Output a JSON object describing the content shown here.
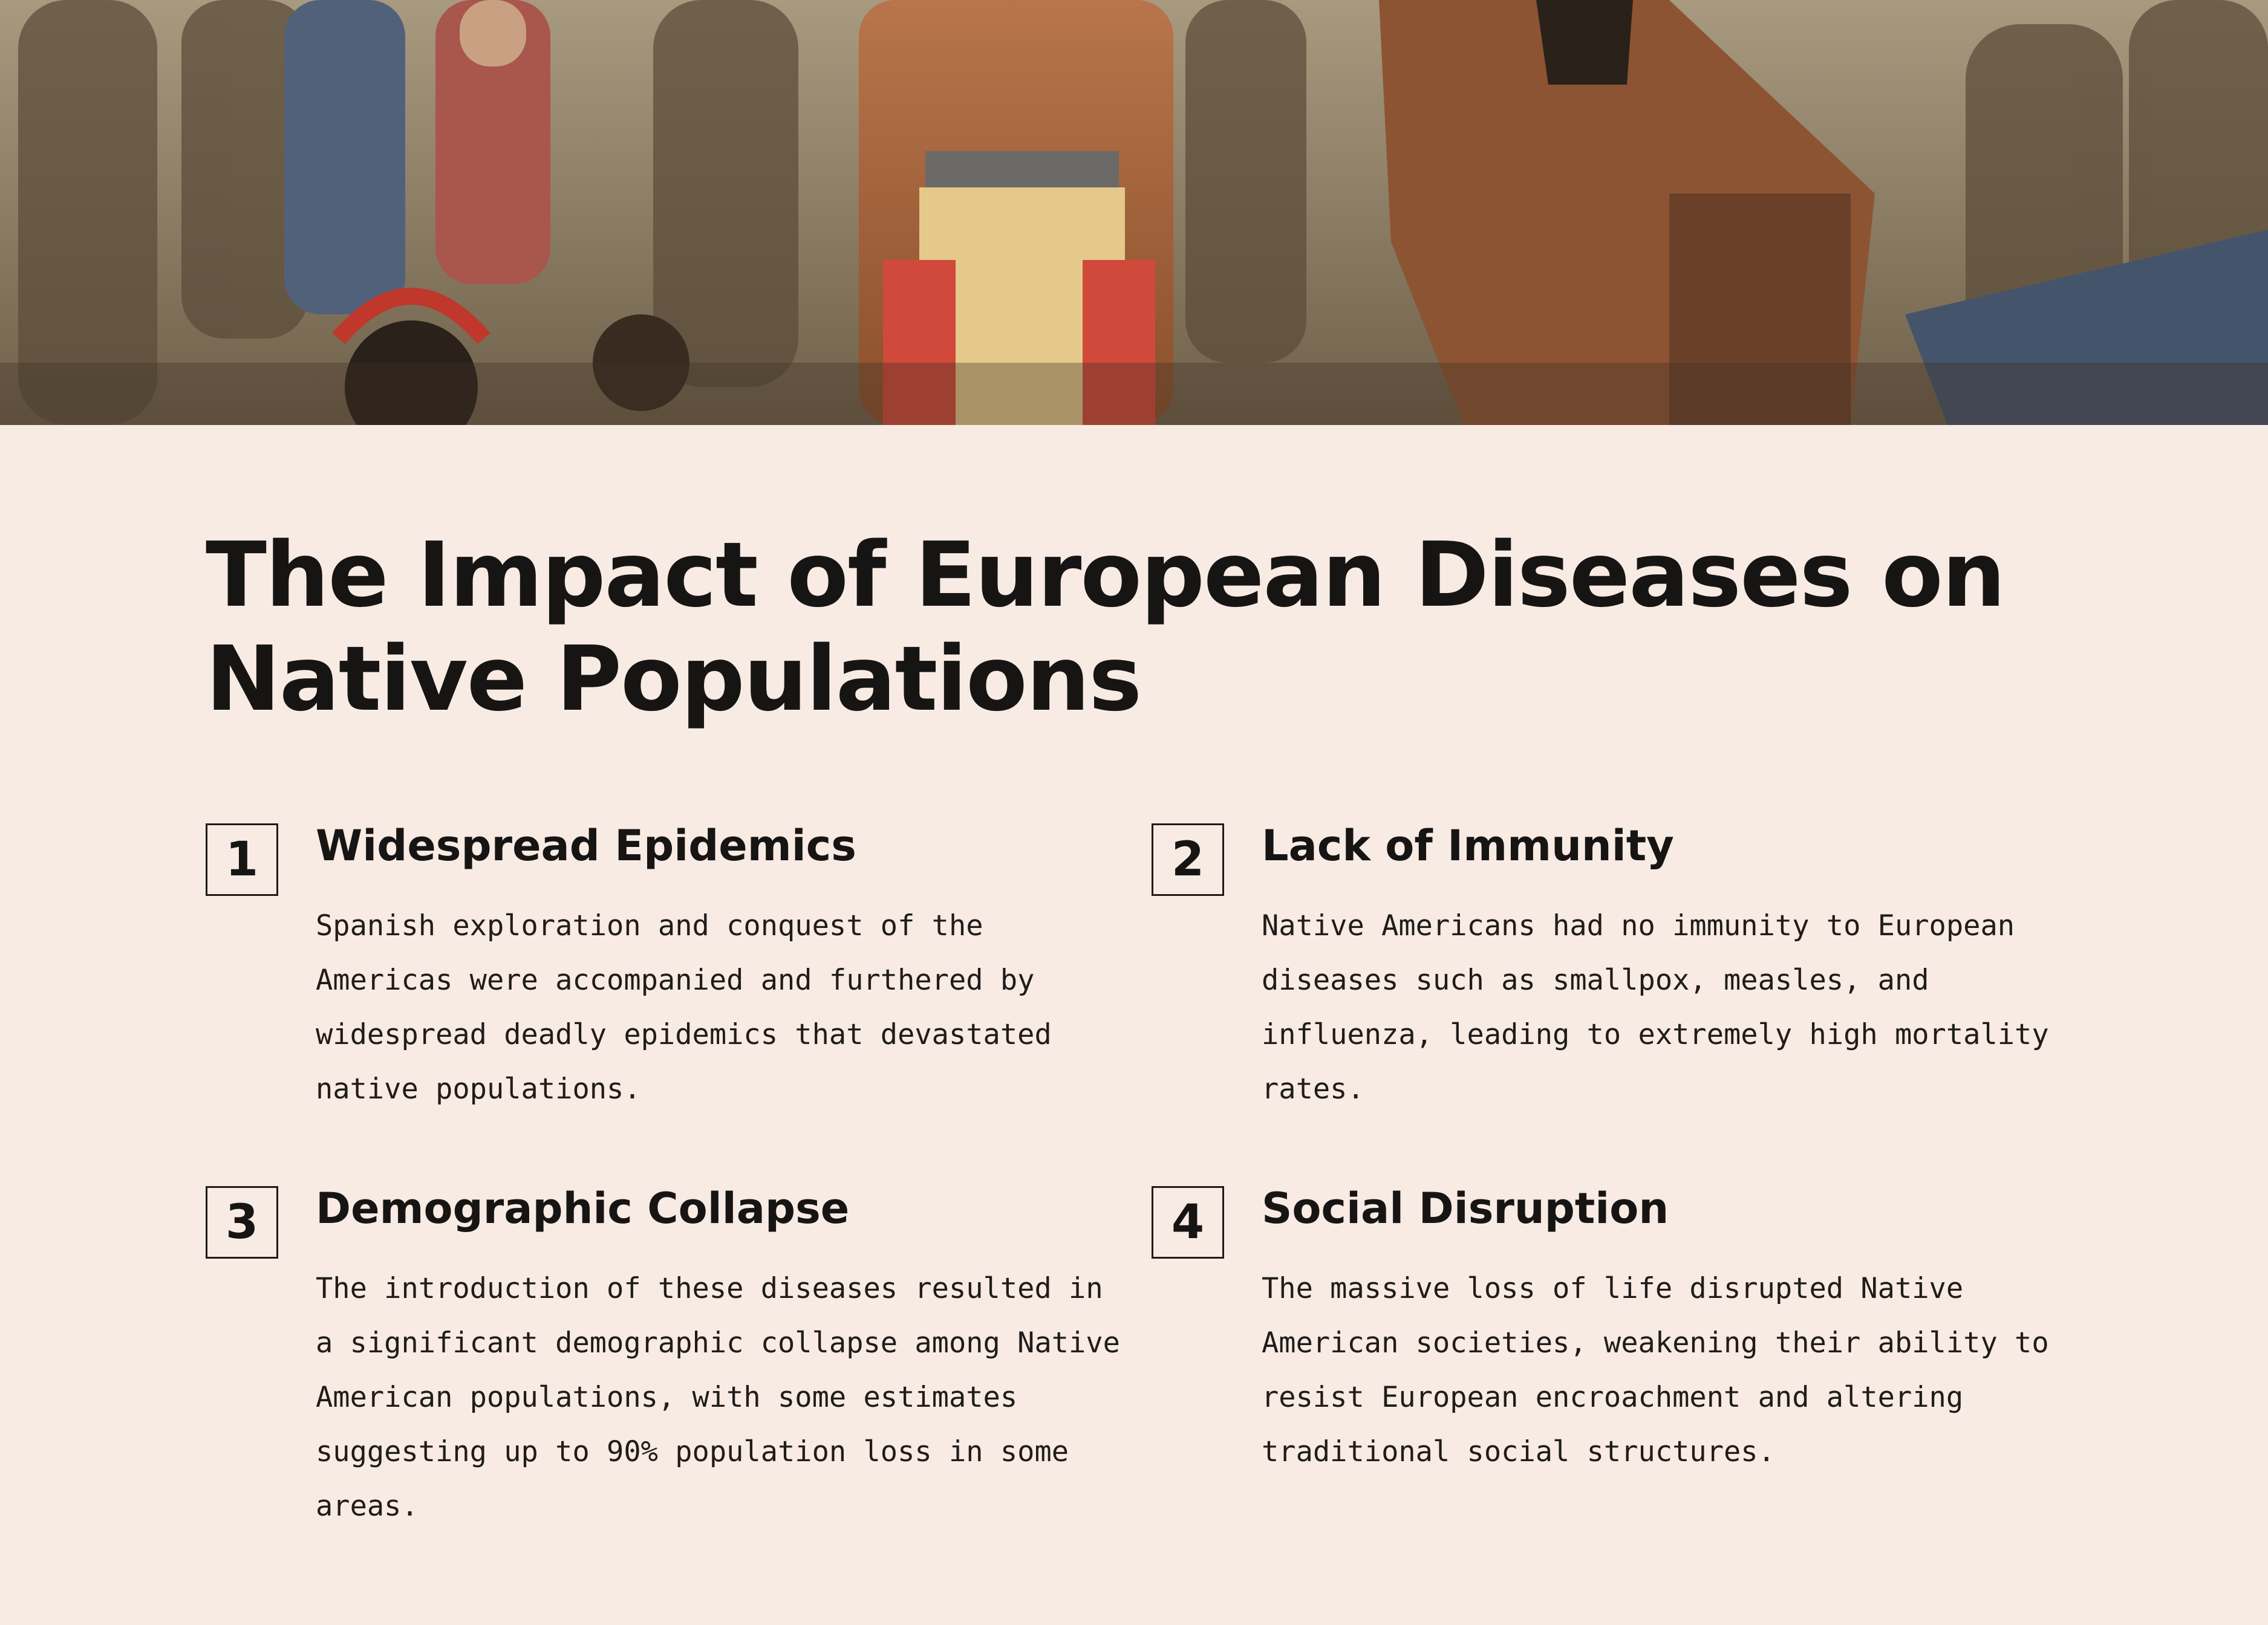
{
  "slide": {
    "title": "The Impact of European Diseases on Native Populations",
    "colors": {
      "background": "#f7ebe3",
      "text": "#171514"
    }
  },
  "items": [
    {
      "number": "1",
      "heading": "Widespread Epidemics",
      "text": "Spanish exploration and conquest of the Americas were accompanied and furthered by widespread deadly epidemics that devastated native populations."
    },
    {
      "number": "2",
      "heading": "Lack of Immunity",
      "text": "Native Americans had no immunity to European diseases such as smallpox, measles, and influenza, leading to extremely high mortality rates."
    },
    {
      "number": "3",
      "heading": "Demographic Collapse",
      "text": "The introduction of these diseases resulted in a significant demographic collapse among Native American populations, with some estimates suggesting up to 90% population loss in some areas."
    },
    {
      "number": "4",
      "heading": "Social Disruption",
      "text": "The massive loss of life disrupted Native American societies, weakening their ability to resist European encroachment and altering traditional social structures."
    }
  ]
}
